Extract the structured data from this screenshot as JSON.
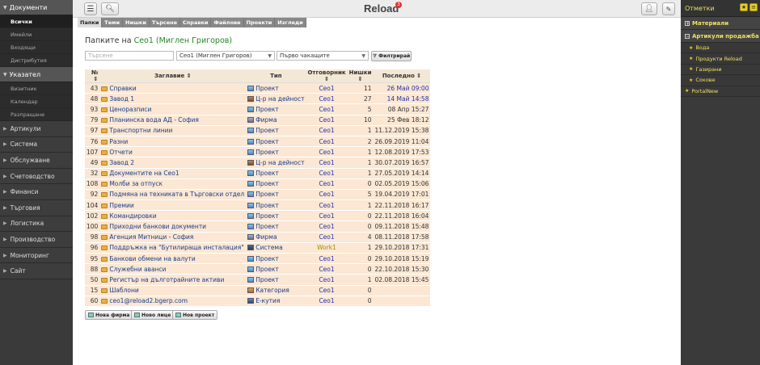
{
  "app": {
    "title": "Reload",
    "notifications": "3"
  },
  "sidebar": {
    "documents": {
      "label": "Документи",
      "subitems": [
        "Всички",
        "Имейли",
        "Входящи",
        "Дистрибутия"
      ]
    },
    "indicator": {
      "label": "Указател",
      "subitems": [
        "Визитник",
        "Календар",
        "Разпращане"
      ]
    },
    "categories": [
      "Артикули",
      "Система",
      "Обслужване",
      "Счетоводство",
      "Финанси",
      "Търговия",
      "Логистика",
      "Производство",
      "Мониторинг",
      "Сайт"
    ]
  },
  "tabs": [
    "Папки",
    "Теми",
    "Нишки",
    "Търсене",
    "Справки",
    "Файлове",
    "Проекти",
    "Изгледи"
  ],
  "heading": {
    "prefix": "Папките на",
    "user": "Сео1 (Миглен Григоров)"
  },
  "filters": {
    "search_placeholder": "Търсене",
    "user_select": "Сео1 (Миглен Григоров)",
    "order_select": "Първо чакащите",
    "filter_button": "Филтрирай"
  },
  "table": {
    "headers": [
      "№",
      "Заглавие",
      "Тип",
      "Отговорник",
      "Нишки",
      "Последно"
    ],
    "rows": [
      {
        "num": "43",
        "title": "Справки",
        "type": "Проект",
        "ticon": "project",
        "owner": "Сео1",
        "threads": "11",
        "last": "26 Май 09:00",
        "recent": true
      },
      {
        "num": "48",
        "title": "Завод 1",
        "type": "Ц-р на дейност",
        "ticon": "dept",
        "owner": "Сео1",
        "threads": "27",
        "last": "14 Май 14:58",
        "recent": true
      },
      {
        "num": "93",
        "title": "Ценоразписи",
        "type": "Проект",
        "ticon": "project",
        "owner": "Сео1",
        "threads": "5",
        "last": "08 Апр 15:27",
        "recent": false
      },
      {
        "num": "79",
        "title": "Планинска вода АД - София",
        "type": "Фирма",
        "ticon": "firm",
        "owner": "Сео1",
        "threads": "10",
        "last": "25 Фев 18:12",
        "recent": false
      },
      {
        "num": "97",
        "title": "Транспортни линии",
        "type": "Проект",
        "ticon": "project",
        "owner": "Сео1",
        "threads": "1",
        "last": "11.12.2019 15:38",
        "recent": false
      },
      {
        "num": "76",
        "title": "Разни",
        "type": "Проект",
        "ticon": "project",
        "owner": "Сео1",
        "threads": "2",
        "last": "26.09.2019 11:04",
        "recent": false
      },
      {
        "num": "107",
        "title": "Отчети",
        "type": "Проект",
        "ticon": "project",
        "owner": "Сео1",
        "threads": "1",
        "last": "12.08.2019 17:53",
        "recent": false
      },
      {
        "num": "49",
        "title": "Завод 2",
        "type": "Ц-р на дейност",
        "ticon": "dept",
        "owner": "Сео1",
        "threads": "1",
        "last": "30.07.2019 16:57",
        "recent": false
      },
      {
        "num": "32",
        "title": "Документите на Сео1",
        "type": "Проект",
        "ticon": "project",
        "owner": "Сео1",
        "threads": "1",
        "last": "27.05.2019 14:14",
        "recent": false
      },
      {
        "num": "108",
        "title": "Молби за отпуск",
        "type": "Проект",
        "ticon": "project",
        "owner": "Сео1",
        "threads": "0",
        "last": "02.05.2019 15:06",
        "recent": false
      },
      {
        "num": "92",
        "title": "Подмяна на техниката в Търговски отдел",
        "type": "Проект",
        "ticon": "project",
        "owner": "Сео1",
        "threads": "5",
        "last": "19.04.2019 17:01",
        "recent": false
      },
      {
        "num": "104",
        "title": "Премии",
        "type": "Проект",
        "ticon": "project",
        "owner": "Сео1",
        "threads": "1",
        "last": "22.11.2018 16:17",
        "recent": false
      },
      {
        "num": "102",
        "title": "Командировки",
        "type": "Проект",
        "ticon": "project",
        "owner": "Сео1",
        "threads": "0",
        "last": "22.11.2018 16:04",
        "recent": false
      },
      {
        "num": "100",
        "title": "Приходни банкови документи",
        "type": "Проект",
        "ticon": "project",
        "owner": "Сео1",
        "threads": "0",
        "last": "09.11.2018 15:48",
        "recent": false
      },
      {
        "num": "98",
        "title": "Агенция Митници - София",
        "type": "Фирма",
        "ticon": "firm",
        "owner": "Сео1",
        "threads": "4",
        "last": "08.11.2018 17:58",
        "recent": false
      },
      {
        "num": "96",
        "title": "Поддръжка на \"Бутилираща инсталация\"",
        "type": "Система",
        "ticon": "system",
        "owner": "Work1",
        "work": true,
        "threads": "1",
        "last": "29.10.2018 17:31",
        "recent": false
      },
      {
        "num": "95",
        "title": "Банкови обмени на валути",
        "type": "Проект",
        "ticon": "project",
        "owner": "Сео1",
        "threads": "0",
        "last": "29.10.2018 15:19",
        "recent": false
      },
      {
        "num": "88",
        "title": "Служебни аванси",
        "type": "Проект",
        "ticon": "project",
        "owner": "Сео1",
        "threads": "0",
        "last": "22.10.2018 15:30",
        "recent": false
      },
      {
        "num": "50",
        "title": "Регистър на дълготрайните активи",
        "type": "Проект",
        "ticon": "project",
        "owner": "Сео1",
        "threads": "1",
        "last": "02.08.2018 15:45",
        "recent": false
      },
      {
        "num": "15",
        "title": "Шаблони",
        "type": "Категория",
        "ticon": "category",
        "owner": "Сео1",
        "threads": "0",
        "last": "",
        "recent": false
      },
      {
        "num": "60",
        "title": "ceo1@reload2.bgerp.com",
        "type": "Е-кутия",
        "ticon": "mailbox",
        "owner": "Сео1",
        "threads": "0",
        "last": "",
        "recent": false
      }
    ]
  },
  "bottom_buttons": [
    "Нова фирма",
    "Ново лице",
    "Нов проект"
  ],
  "rightbar": {
    "title": "Отметки",
    "sections": [
      {
        "label": "Материали",
        "items": []
      },
      {
        "label": "Артикули продажба",
        "items": [
          "Вода",
          "Продукти Reload",
          "Газирани",
          "Сокове"
        ]
      }
    ],
    "extra_item": "PortalNew"
  }
}
